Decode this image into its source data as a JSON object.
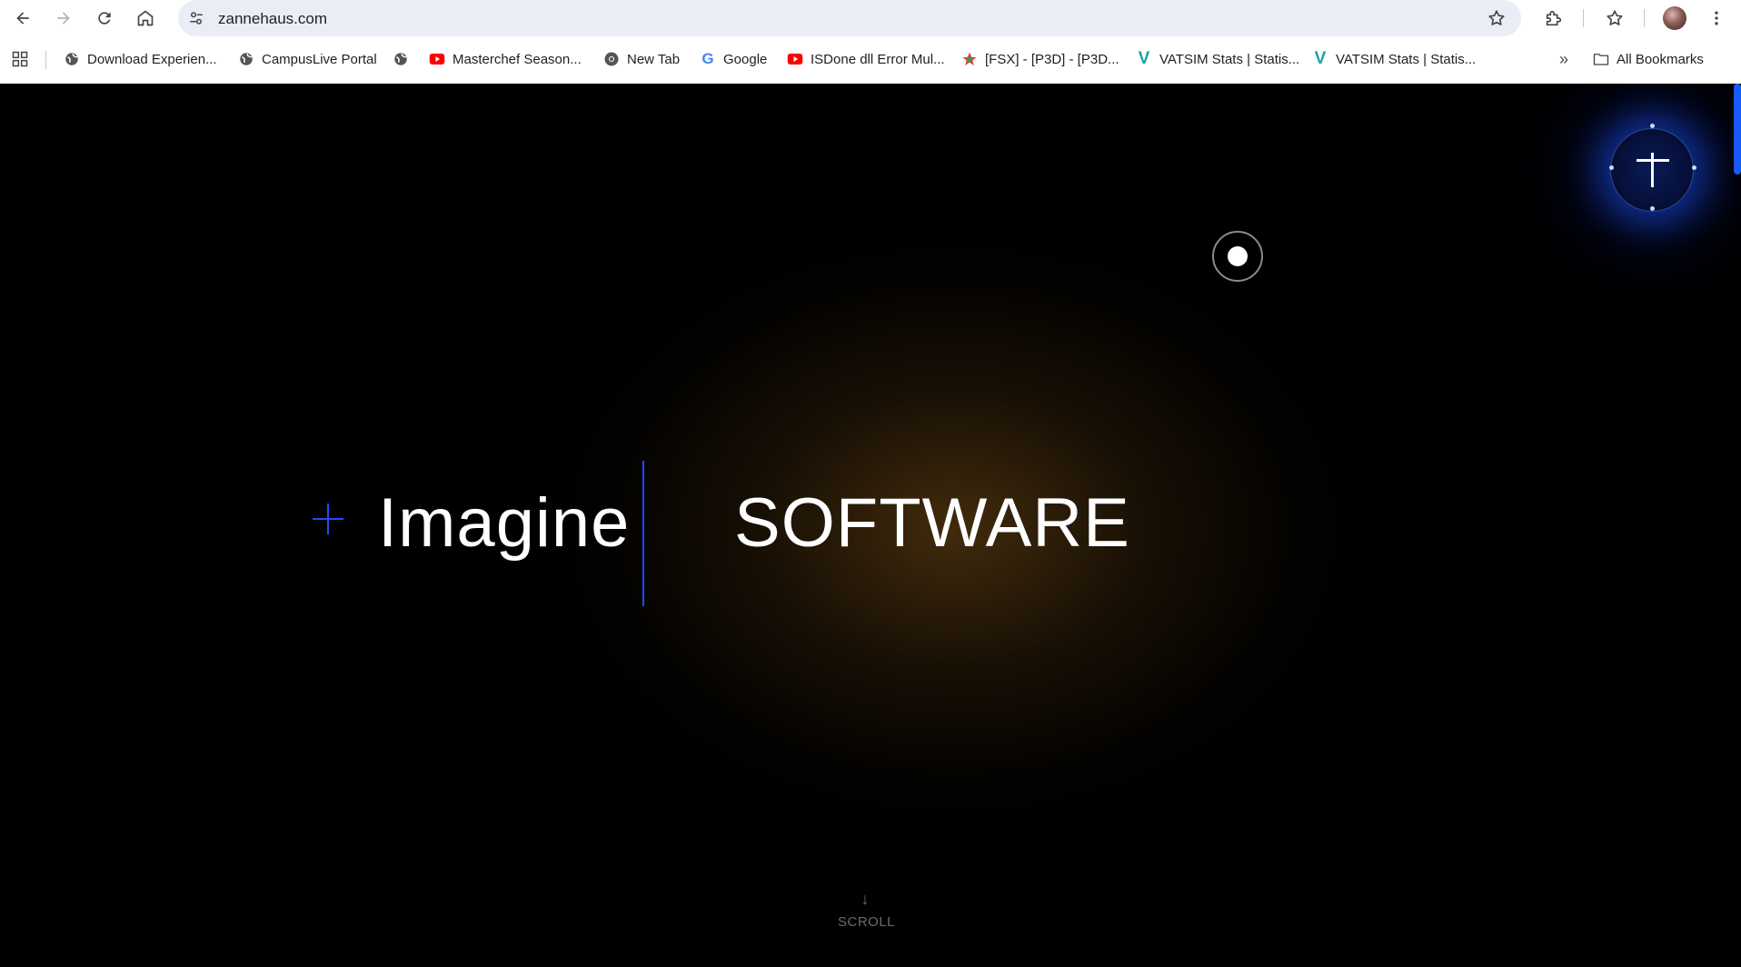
{
  "browser": {
    "url": "zannehaus.com",
    "profile_icon": "avatar",
    "bookmarks": [
      {
        "label": "Download Experien...",
        "icon": "globe-icon"
      },
      {
        "label": "CampusLive Portal",
        "icon": "globe-icon"
      },
      {
        "label": "",
        "icon": "globe-icon"
      },
      {
        "label": "Masterchef Season...",
        "icon": "youtube-icon"
      },
      {
        "label": "New Tab",
        "icon": "chrome-icon"
      },
      {
        "label": "Google",
        "icon": "google-icon"
      },
      {
        "label": "ISDone dll Error Mul...",
        "icon": "youtube-icon"
      },
      {
        "label": "[FSX] - [P3D] - [P3D...",
        "icon": "star-logo-icon"
      },
      {
        "label": "VATSIM Stats | Statis...",
        "icon": "vatsim-icon"
      },
      {
        "label": "VATSIM Stats | Statis...",
        "icon": "vatsim-icon"
      }
    ],
    "all_bookmarks_label": "All Bookmarks",
    "overflow_glyph": "»"
  },
  "page": {
    "hero_left": "Imagine",
    "hero_right": "SOFTWARE",
    "scroll_label": "SCROLL",
    "scroll_arrow": "↓",
    "accent_color": "#2548ff"
  }
}
